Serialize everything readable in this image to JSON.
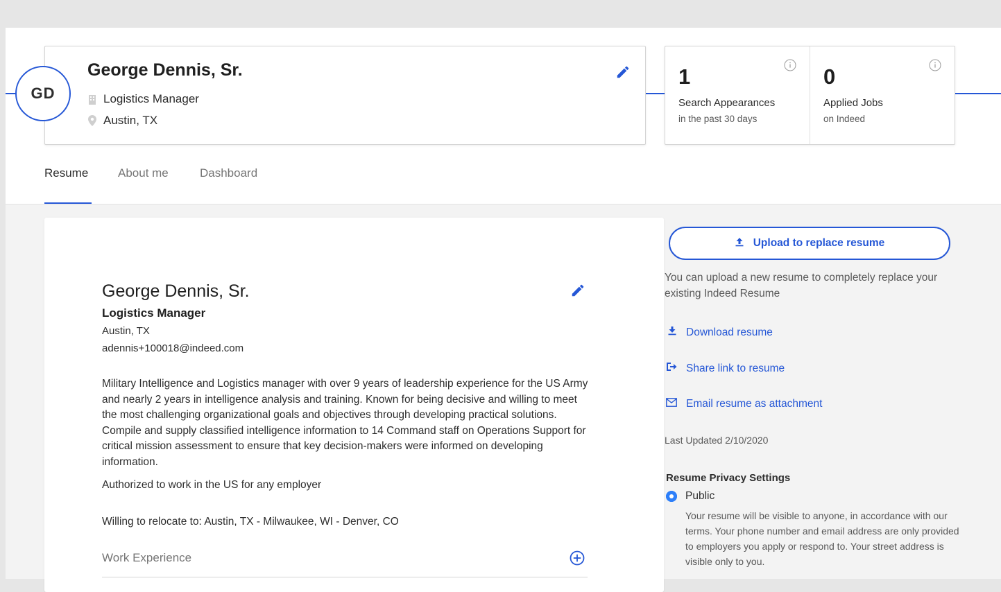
{
  "profile": {
    "initials": "GD",
    "name": "George Dennis, Sr.",
    "title": "Logistics Manager",
    "location": "Austin, TX"
  },
  "stats": [
    {
      "number": "1",
      "label": "Search Appearances",
      "sub": "in the past 30 days"
    },
    {
      "number": "0",
      "label": "Applied Jobs",
      "sub": "on Indeed"
    }
  ],
  "tabs": [
    {
      "label": "Resume",
      "active": true
    },
    {
      "label": "About me",
      "active": false
    },
    {
      "label": "Dashboard",
      "active": false
    }
  ],
  "resume": {
    "name": "George Dennis, Sr.",
    "title": "Logistics Manager",
    "location": "Austin, TX",
    "email": "adennis+100018@indeed.com",
    "summary": "Military Intelligence and Logistics manager with over 9 years of leadership experience for the US Army and nearly 2 years in intelligence analysis and training. Known for being decisive and willing to meet the most challenging organizational goals and objectives through developing practical solutions. Compile and supply classified intelligence information to 14 Command staff on Operations Support for critical mission assessment to ensure that key decision-makers were informed on developing information.",
    "work_authorization": "Authorized to work in the US for any employer",
    "relocate": "Willing to relocate to: Austin, TX - Milwaukee, WI - Denver, CO",
    "section_work_experience": "Work Experience"
  },
  "sidebar": {
    "upload_label": "Upload to replace resume",
    "upload_help": "You can upload a new resume to completely replace your existing Indeed Resume",
    "download_label": "Download resume",
    "share_label": "Share link to resume",
    "email_label": "Email resume as attachment",
    "last_updated": "Last Updated 2/10/2020",
    "privacy_title": "Resume Privacy Settings",
    "privacy_option": "Public",
    "privacy_desc": "Your resume will be visible to anyone, in accordance with our terms. Your phone number and email address are only provided to employers you apply or respond to. Your street address is visible only to you."
  },
  "colors": {
    "accent": "#2557d6",
    "radio": "#2d7ff9",
    "muted_text": "#595959",
    "background": "#f3f3f3"
  }
}
